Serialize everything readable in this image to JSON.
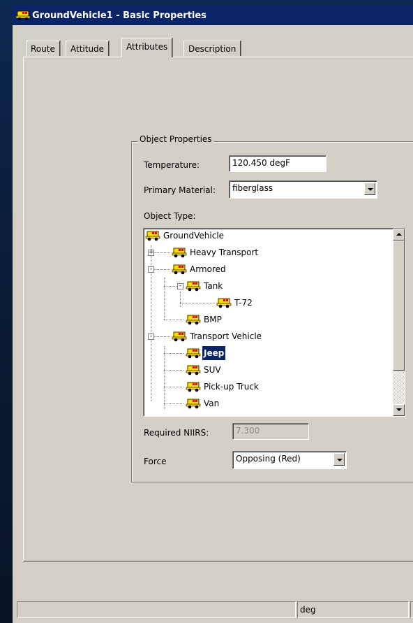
{
  "window": {
    "title": "GroundVehicle1 - Basic Properties"
  },
  "tabs": [
    {
      "label": "Route"
    },
    {
      "label": "Attitude"
    },
    {
      "label": "Attributes",
      "active": true
    },
    {
      "label": "Description"
    }
  ],
  "group": {
    "title": "Object Properties",
    "temperature": {
      "label": "Temperature:",
      "value": "120.450 degF"
    },
    "primary_material": {
      "label": "Primary Material:",
      "value": "fiberglass"
    },
    "object_type": {
      "label": "Object Type:"
    },
    "tree": [
      {
        "label": "GroundVehicle"
      },
      {
        "label": "Heavy Transport",
        "expander": "+"
      },
      {
        "label": "Armored",
        "expander": "-"
      },
      {
        "label": "Tank",
        "expander": "-"
      },
      {
        "label": "T-72"
      },
      {
        "label": "BMP"
      },
      {
        "label": "Transport Vehicle",
        "expander": "-"
      },
      {
        "label": "Jeep",
        "selected": true
      },
      {
        "label": "SUV"
      },
      {
        "label": "Pick-up Truck"
      },
      {
        "label": "Van"
      }
    ],
    "required_niirs": {
      "label": "Required NIIRS:",
      "value": "7.300"
    },
    "force": {
      "label": "Force",
      "value": "Opposing (Red)"
    }
  },
  "statusbar": {
    "unit": "deg"
  },
  "colors": {
    "titlebar": "#0a246a",
    "selection": "#0a246a",
    "face": "#d4d0c8"
  },
  "icons": {
    "vehicle": "vehicle-icon"
  }
}
